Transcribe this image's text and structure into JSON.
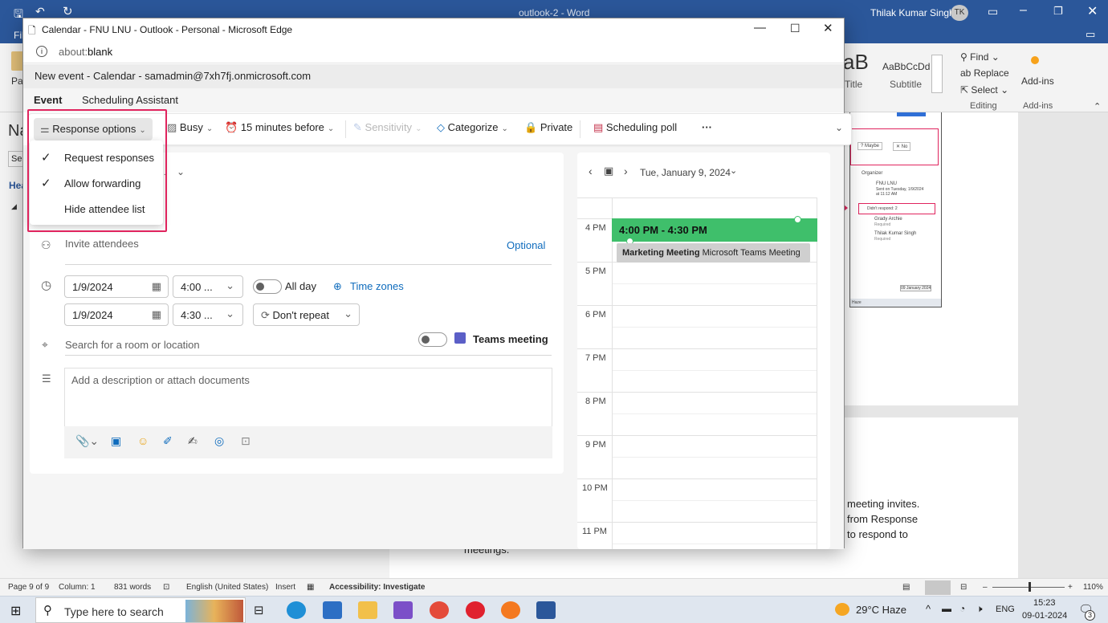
{
  "word": {
    "title": "outlook-2 - Word",
    "user": "Thilak Kumar Singh",
    "user_initials": "TK",
    "ribbon": {
      "find": "Find",
      "replace": "Replace",
      "select": "Select",
      "editing": "Editing",
      "addins": "Add-ins",
      "addins_group": "Add-ins",
      "style1": "AaBbCcDd",
      "style1_name": "Subtitle",
      "style0_name": "Title",
      "style0": "aB",
      "paste": "Pas",
      "file": "Fil"
    },
    "left_labels": {
      "na": "Na",
      "se": "Se",
      "hea": "Hea"
    },
    "doc_text": [
      " meeting invites.",
      " from Response",
      " to respond to",
      "meetings."
    ],
    "status": {
      "page": "Page 9 of 9",
      "column": "Column: 1",
      "words": "831 words",
      "language": "English (United States)",
      "insert": "Insert",
      "accessibility": "Accessibility: Investigate",
      "zoom": "110%"
    },
    "thumb": {
      "maybe": "? Maybe",
      "no": "✕ No",
      "organizer_label": "Organizer",
      "organizer": "FNU LNU",
      "sent": "Sent on Tuesday, 1/9/2024 at 11:12 AM",
      "didnt": "Didn't respond: 2",
      "a1": "Grady Archie",
      "a2": "Thilak Kumar Singh",
      "req": "Required",
      "date_tip": "09 January 2024",
      "haze": "Haze",
      "eng": "ENG"
    }
  },
  "taskbar": {
    "search_placeholder": "Type here to search",
    "weather": "29°C  Haze",
    "lang": "ENG",
    "time": "15:23",
    "date": "09-01-2024",
    "notif": "3"
  },
  "edge": {
    "window_title": "Calendar - FNU LNU - Outlook - Personal - Microsoft Edge",
    "url_prefix": "about:",
    "url_main": "blank"
  },
  "outlook": {
    "header": "New event - Calendar - samadmin@7xh7fj.onmicrosoft.com",
    "tabs": [
      "Event",
      "Scheduling Assistant"
    ],
    "toolbar": {
      "response_options": "Response options",
      "busy": "Busy",
      "reminder": "15 minutes before",
      "sensitivity": "Sensitivity",
      "categorize": "Categorize",
      "private": "Private",
      "scheduling_poll": "Scheduling poll",
      "more": "···"
    },
    "menu": [
      {
        "label": "Request responses",
        "checked": "✓"
      },
      {
        "label": "Allow forwarding",
        "checked": "✓"
      },
      {
        "label": "Hide attendee list",
        "checked": ""
      }
    ],
    "form": {
      "attendees_placeholder": "Invite attendees",
      "optional": "Optional",
      "start_date": "1/9/2024",
      "start_time": "4:00 ...",
      "end_date": "1/9/2024",
      "end_time": "4:30 ...",
      "all_day": "All day",
      "time_zones": "Time zones",
      "repeat": "Don't repeat",
      "location_placeholder": "Search for a room or location",
      "teams": "Teams meeting",
      "description_placeholder": "Add a description or attach documents"
    },
    "calendar": {
      "date": "Tue, January 9, 2024",
      "hours": [
        "4 PM",
        "5 PM",
        "6 PM",
        "7 PM",
        "8 PM",
        "9 PM",
        "10 PM",
        "11 PM"
      ],
      "new_event_time": "4:00 PM - 4:30 PM",
      "existing_title": "Marketing Meeting",
      "existing_sub": "Microsoft Teams Meeting"
    }
  }
}
